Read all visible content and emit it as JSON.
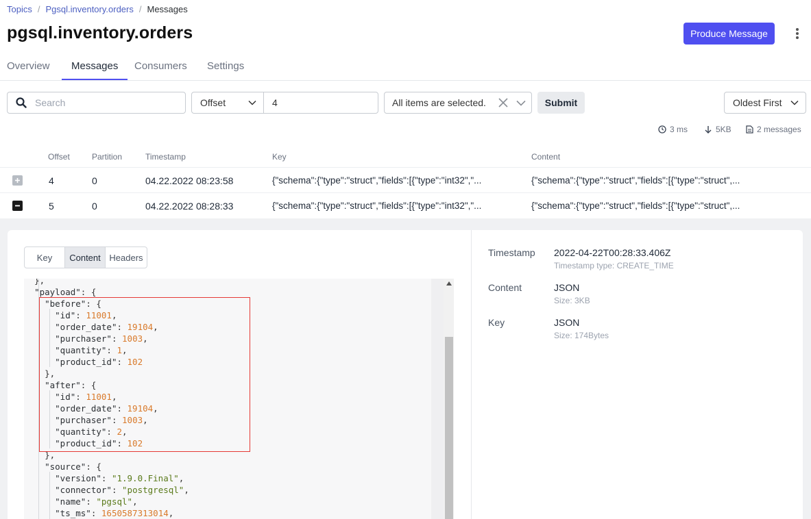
{
  "breadcrumb": {
    "topics": "Topics",
    "topic": "Pgsql.inventory.orders",
    "current": "Messages",
    "sep": "/"
  },
  "page_title": "pgsql.inventory.orders",
  "header": {
    "produce_label": "Produce Message"
  },
  "tabs": [
    {
      "label": "Overview"
    },
    {
      "label": "Messages",
      "active": true
    },
    {
      "label": "Consumers"
    },
    {
      "label": "Settings"
    }
  ],
  "filters": {
    "search_placeholder": "Search",
    "seek_type": "Offset",
    "offset_value": "4",
    "partitions": "All items are selected.",
    "submit_label": "Submit",
    "sort": "Oldest First"
  },
  "stats": {
    "time": "3 ms",
    "size": "5KB",
    "messages": "2 messages"
  },
  "table": {
    "columns": [
      "Offset",
      "Partition",
      "Timestamp",
      "Key",
      "Content"
    ],
    "rows": [
      {
        "offset": "4",
        "partition": "0",
        "timestamp": "04.22.2022 08:23:58",
        "key": "{\"schema\":{\"type\":\"struct\",\"fields\":[{\"type\":\"int32\",\"...",
        "content": "{\"schema\":{\"type\":\"struct\",\"fields\":[{\"type\":\"struct\",...",
        "expanded": false
      },
      {
        "offset": "5",
        "partition": "0",
        "timestamp": "04.22.2022 08:28:33",
        "key": "{\"schema\":{\"type\":\"struct\",\"fields\":[{\"type\":\"int32\",\"...",
        "content": "{\"schema\":{\"type\":\"struct\",\"fields\":[{\"type\":\"struct\",...",
        "expanded": true
      }
    ]
  },
  "detail": {
    "view_tabs": [
      "Key",
      "Content",
      "Headers"
    ],
    "active_view": "Content",
    "code_lines": [
      [
        {
          "t": "  },",
          "c": "p"
        }
      ],
      [
        {
          "t": "  ",
          "c": "p"
        },
        {
          "t": "\"payload\"",
          "c": "k"
        },
        {
          "t": ": {",
          "c": "p"
        }
      ],
      [
        {
          "t": "    ",
          "c": "p"
        },
        {
          "t": "\"before\"",
          "c": "k"
        },
        {
          "t": ": {",
          "c": "p"
        }
      ],
      [
        {
          "t": "      ",
          "c": "p"
        },
        {
          "t": "\"id\"",
          "c": "k"
        },
        {
          "t": ": ",
          "c": "p"
        },
        {
          "t": "11001",
          "c": "num"
        },
        {
          "t": ",",
          "c": "p"
        }
      ],
      [
        {
          "t": "      ",
          "c": "p"
        },
        {
          "t": "\"order_date\"",
          "c": "k"
        },
        {
          "t": ": ",
          "c": "p"
        },
        {
          "t": "19104",
          "c": "num"
        },
        {
          "t": ",",
          "c": "p"
        }
      ],
      [
        {
          "t": "      ",
          "c": "p"
        },
        {
          "t": "\"purchaser\"",
          "c": "k"
        },
        {
          "t": ": ",
          "c": "p"
        },
        {
          "t": "1003",
          "c": "num"
        },
        {
          "t": ",",
          "c": "p"
        }
      ],
      [
        {
          "t": "      ",
          "c": "p"
        },
        {
          "t": "\"quantity\"",
          "c": "k"
        },
        {
          "t": ": ",
          "c": "p"
        },
        {
          "t": "1",
          "c": "num"
        },
        {
          "t": ",",
          "c": "p"
        }
      ],
      [
        {
          "t": "      ",
          "c": "p"
        },
        {
          "t": "\"product_id\"",
          "c": "k"
        },
        {
          "t": ": ",
          "c": "p"
        },
        {
          "t": "102",
          "c": "num"
        }
      ],
      [
        {
          "t": "    },",
          "c": "p"
        }
      ],
      [
        {
          "t": "    ",
          "c": "p"
        },
        {
          "t": "\"after\"",
          "c": "k"
        },
        {
          "t": ": {",
          "c": "p"
        }
      ],
      [
        {
          "t": "      ",
          "c": "p"
        },
        {
          "t": "\"id\"",
          "c": "k"
        },
        {
          "t": ": ",
          "c": "p"
        },
        {
          "t": "11001",
          "c": "num"
        },
        {
          "t": ",",
          "c": "p"
        }
      ],
      [
        {
          "t": "      ",
          "c": "p"
        },
        {
          "t": "\"order_date\"",
          "c": "k"
        },
        {
          "t": ": ",
          "c": "p"
        },
        {
          "t": "19104",
          "c": "num"
        },
        {
          "t": ",",
          "c": "p"
        }
      ],
      [
        {
          "t": "      ",
          "c": "p"
        },
        {
          "t": "\"purchaser\"",
          "c": "k"
        },
        {
          "t": ": ",
          "c": "p"
        },
        {
          "t": "1003",
          "c": "num"
        },
        {
          "t": ",",
          "c": "p"
        }
      ],
      [
        {
          "t": "      ",
          "c": "p"
        },
        {
          "t": "\"quantity\"",
          "c": "k"
        },
        {
          "t": ": ",
          "c": "p"
        },
        {
          "t": "2",
          "c": "num"
        },
        {
          "t": ",",
          "c": "p"
        }
      ],
      [
        {
          "t": "      ",
          "c": "p"
        },
        {
          "t": "\"product_id\"",
          "c": "k"
        },
        {
          "t": ": ",
          "c": "p"
        },
        {
          "t": "102",
          "c": "num"
        }
      ],
      [
        {
          "t": "    },",
          "c": "p"
        }
      ],
      [
        {
          "t": "    ",
          "c": "p"
        },
        {
          "t": "\"source\"",
          "c": "k"
        },
        {
          "t": ": {",
          "c": "p"
        }
      ],
      [
        {
          "t": "      ",
          "c": "p"
        },
        {
          "t": "\"version\"",
          "c": "k"
        },
        {
          "t": ": ",
          "c": "p"
        },
        {
          "t": "\"1.9.0.Final\"",
          "c": "str"
        },
        {
          "t": ",",
          "c": "p"
        }
      ],
      [
        {
          "t": "      ",
          "c": "p"
        },
        {
          "t": "\"connector\"",
          "c": "k"
        },
        {
          "t": ": ",
          "c": "p"
        },
        {
          "t": "\"postgresql\"",
          "c": "str"
        },
        {
          "t": ",",
          "c": "p"
        }
      ],
      [
        {
          "t": "      ",
          "c": "p"
        },
        {
          "t": "\"name\"",
          "c": "k"
        },
        {
          "t": ": ",
          "c": "p"
        },
        {
          "t": "\"pgsql\"",
          "c": "str"
        },
        {
          "t": ",",
          "c": "p"
        }
      ],
      [
        {
          "t": "      ",
          "c": "p"
        },
        {
          "t": "\"ts_ms\"",
          "c": "k"
        },
        {
          "t": ": ",
          "c": "p"
        },
        {
          "t": "1650587313014",
          "c": "num"
        },
        {
          "t": ",",
          "c": "p"
        }
      ]
    ],
    "meta": {
      "timestamp_label": "Timestamp",
      "timestamp_value": "2022-04-22T00:28:33.406Z",
      "timestamp_sub": "Timestamp type: CREATE_TIME",
      "content_label": "Content",
      "content_value": "JSON",
      "content_sub": "Size: 3KB",
      "key_label": "Key",
      "key_value": "JSON",
      "key_sub": "Size: 174Bytes"
    }
  },
  "colors": {
    "accent": "#4f4ff0",
    "json_string": "#5a7a1a",
    "json_number": "#d97a2b",
    "highlight_border": "#e53935"
  },
  "icons": [
    "search-icon",
    "chevron-down-icon",
    "close-icon",
    "clock-icon",
    "arrow-down-icon",
    "file-icon",
    "plus-icon",
    "minus-icon",
    "kebab-menu-icon"
  ]
}
